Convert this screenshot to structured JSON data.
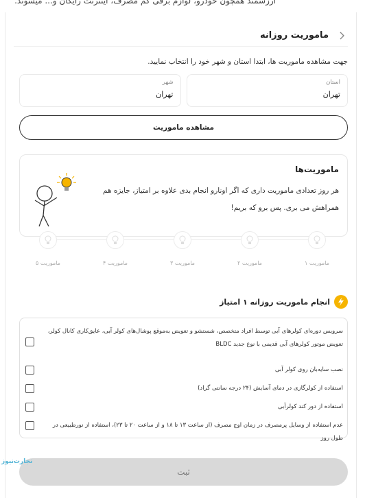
{
  "top_text": "ارزشمند همچون خودرو، لوازم برقی کم مصرف، اینترنت رایگان و... میشوند.",
  "header": {
    "title": "ماموریت روزانه"
  },
  "intro": "جهت مشاهده ماموریت ها، ابتدا استان و شهر خود را انتخاب نمایید.",
  "province": {
    "label": "استان",
    "value": "تهران"
  },
  "city": {
    "label": "شهر",
    "value": "تهران"
  },
  "view_button": "مشاهده ماموریت",
  "missions_card": {
    "title": "ماموریت‌ها",
    "text": "هر روز تعدادی ماموریت داری که اگر اونارو انجام بدی علاوه بر امتیاز، جایزه هم همراهش می بری. پس برو که بریم!"
  },
  "steps": [
    "ماموریت ۱",
    "ماموریت ۲",
    "ماموریت ۳",
    "ماموریت ۴",
    "ماموریت ۵"
  ],
  "task": {
    "title": "انجام ماموریت روزانه ۱ امتیاز"
  },
  "checklist": [
    "سرویس دوره‌ای کولرهای آبی توسط افراد متخصص، شستشو و تعویض به‌موقع پوشال‌های کولر آبی، عایق‌کاری کانال کولر، تعویض موتور کولرهای آبی قدیمی با نوع جدید BLDC",
    "نصب سایه‌بان روی کولر آبی",
    "استفاده از کولرگازی در دمای آسایش (۲۴ درجه سانتی گراد)",
    "استفاده از دور کند کولرآبی",
    "عدم استفاده از وسایل پرمصرف در زمان اوج مصرف (از ساعت ۱۳ تا ۱۸ و از ساعت ۲۰ تا ۲۳)، استفاده از نورطبیعی در طول روز"
  ],
  "submit_button": "ثبت",
  "watermark": "تجارت‌نیوز",
  "colors": {
    "accent": "#f6b400",
    "border": "#e6e6e6",
    "disabled": "#d9d9d9"
  }
}
